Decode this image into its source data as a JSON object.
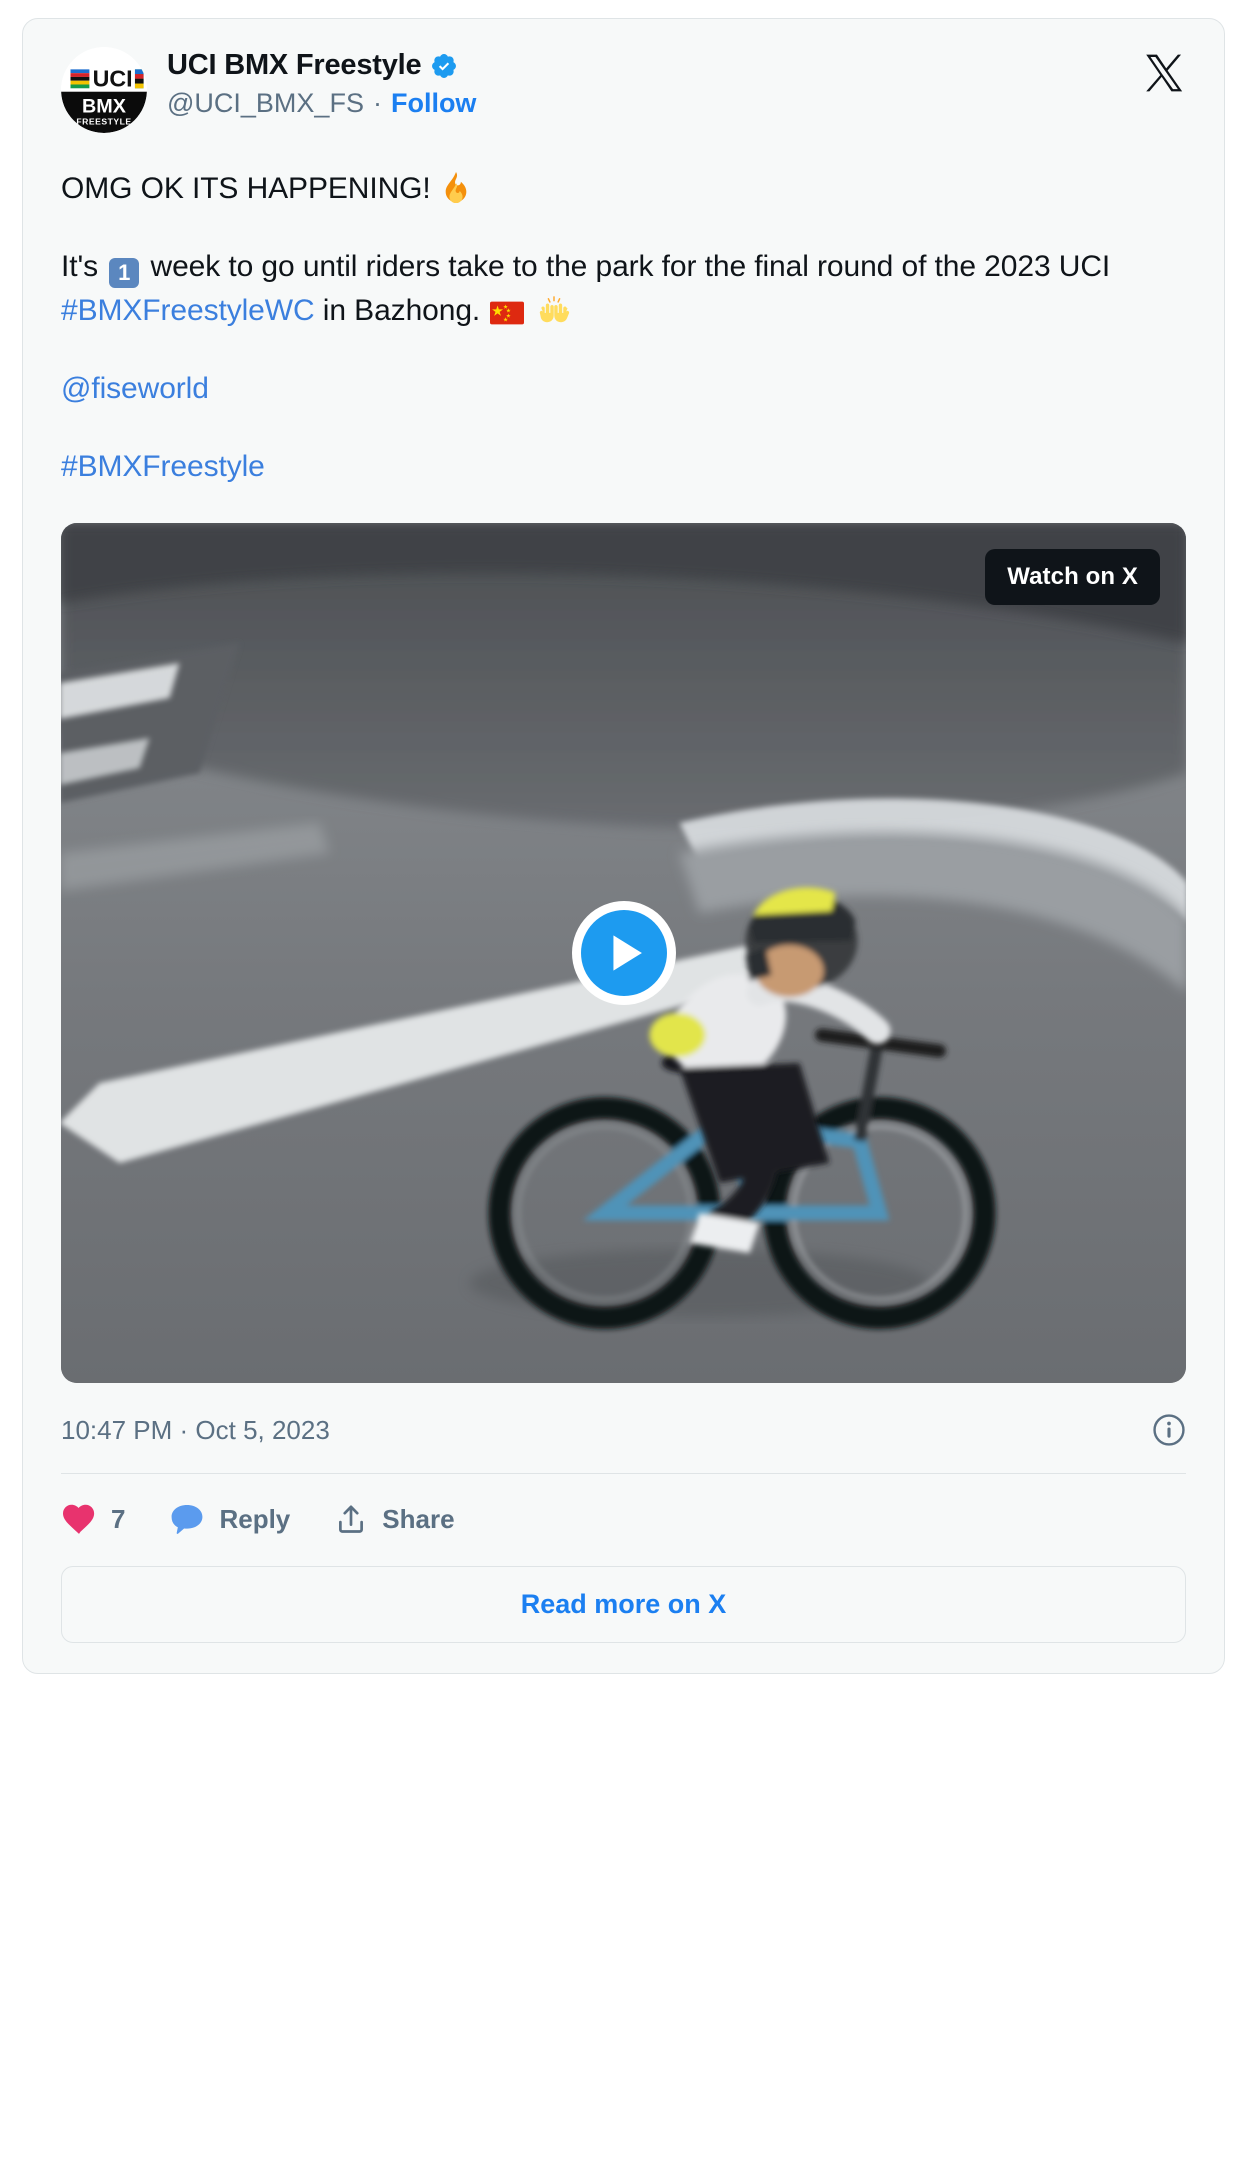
{
  "card": {
    "platform_logo": "x-logo",
    "background_color": "#f7f9f9",
    "border_color": "#dfe4e6"
  },
  "author": {
    "display_name": "UCI BMX Freestyle",
    "verified": true,
    "verified_icon": "verified-badge-icon",
    "handle": "@UCI_BMX_FS",
    "separator": "·",
    "follow_label": "Follow",
    "avatar_icon": "uci-bmx-freestyle-avatar",
    "avatar_text_top": "UCI",
    "avatar_text_mid": "BMX",
    "avatar_text_bottom": "FREESTYLE"
  },
  "post": {
    "line1_text": "OMG OK ITS HAPPENING!",
    "line1_emoji": "fire-emoji",
    "line2_prefix": "It's",
    "line2_keycap": "1",
    "line2_mid": "week to go until riders take to the park for the final round of the 2023 UCI",
    "line2_hashtag": "#BMXFreestyleWC",
    "line2_suffix": "in Bazhong.",
    "line2_flag_emoji": "flag-china-emoji",
    "line2_hands_emoji": "raising-hands-emoji",
    "mention": "@fiseworld",
    "hashtag": "#BMXFreestyle",
    "link_color": "#3b7fde"
  },
  "media": {
    "type": "video",
    "watch_badge_label": "Watch on X",
    "play_button_icon": "play-icon",
    "alt": "BMX rider riding a blue BMX bike in a concrete skate park"
  },
  "meta": {
    "timestamp": "10:47 PM · Oct 5, 2023",
    "info_icon": "info-circle-icon"
  },
  "actions": {
    "like": {
      "icon": "heart-icon",
      "count": "7",
      "color": "#e8336e"
    },
    "reply": {
      "icon": "reply-bubble-icon",
      "label": "Reply",
      "color": "#5b9bee"
    },
    "share": {
      "icon": "share-upload-icon",
      "label": "Share"
    }
  },
  "footer": {
    "read_more_label": "Read more on X"
  }
}
